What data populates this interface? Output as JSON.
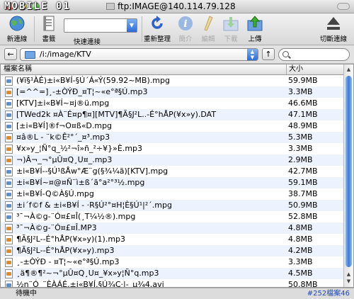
{
  "window": {
    "title": "ftp:IMAGE@140.114.79.128",
    "watermark": "MOBILE 01"
  },
  "toolbar": {
    "new_connection": "新連線",
    "bookmarks": "書籤",
    "quick_connect": "快速連接",
    "refresh": "重新整理",
    "info": "簡介",
    "edit": "編輯",
    "download": "下載",
    "upload": "上傳",
    "disconnect": "切斷連線"
  },
  "pathbar": {
    "path": "/i:/image/KTV",
    "back_label": "←",
    "up_label": "↑"
  },
  "list": {
    "header_name": "檔案名稱",
    "header_size": "大小",
    "rows": [
      {
        "name": "(¥ï§¹ÀÉ)±i«B¥Í-§Ú´Á«Ý(59.92~MB).mpg",
        "size": "59.9MB",
        "kind": "video"
      },
      {
        "name": "[=^^=]¸-±ÒÝÐ_¤T¦~«e°ª§Ú.mp3",
        "size": "3.3MB",
        "kind": "audio"
      },
      {
        "name": "[KTV]±i«B¥Í~¤j®ü.mpg",
        "size": "46.6MB",
        "kind": "video"
      },
      {
        "name": "[TWed2k ¤À¨É¤p¶¤][MTV]¶Ã§J²L..-É°hÅP(¥x»y).DAT",
        "size": "47.1MB",
        "kind": "video"
      },
      {
        "name": "[±i«B¥Í]®f¬O¤ß«D.mpg",
        "size": "48.9MB",
        "kind": "video"
      },
      {
        "name": "¤â®L - ¨k©Ê²°´_¤³.mp3",
        "size": "5.3MB",
        "kind": "audio"
      },
      {
        "name": "¥x»y_¦Ñ°q_½²¬î»ñ_²÷¥}»È.mp3",
        "size": "3.3MB",
        "kind": "audio"
      },
      {
        "name": "¬)Â¬_¬°µÛ¤Q¸U¤_.mp3",
        "size": "2.9MB",
        "kind": "audio"
      },
      {
        "name": "±i«B¥Í--§Ú¹ßÅw°Æ¨g(§¾¼ã)[KTV].mpg",
        "size": "42.7MB",
        "kind": "video"
      },
      {
        "name": "±i«B¥Í~¤@¤Ñ¨ì±ß´ã°a²°³½.mpg",
        "size": "59.1MB",
        "kind": "video"
      },
      {
        "name": "±i«B¥Í-Q©À§Ú.mpg",
        "size": "38.7MB",
        "kind": "video"
      },
      {
        "name": "±i´f©f & ±i«B¥Í - ·R§Ú²°¤H¦È§Ú¹|²´.mpg",
        "size": "50.9MB",
        "kind": "video"
      },
      {
        "name": "³¯¬À©g-¨Ó¤£¤Î(¸T¼½®).mpg",
        "size": "52.8MB",
        "kind": "video"
      },
      {
        "name": "³¯¬À©g-¨Ó¤£¤Î.MP3",
        "size": "4.8MB",
        "kind": "audio"
      },
      {
        "name": "¶Ã§J²L--É°hÅP(¥x»y)(1).mp3",
        "size": "4.8MB",
        "kind": "audio"
      },
      {
        "name": "¶Ã§J²L--É°hÅP(¥x»y).mp3",
        "size": "4.2MB",
        "kind": "audio"
      },
      {
        "name": "¸-±ÒÝÐ - ¤T¦~«e°ª§Ú.mp3",
        "size": "3.3MB",
        "kind": "audio"
      },
      {
        "name": "¸ä¶®¶²~¬°µÛ¤Q¸U¤_¥x»y¦Ñ°q.mp3",
        "size": "4.5MB",
        "kind": "audio"
      },
      {
        "name": "½n¨Ó¸¨ÈÀÁÉ.±i«B¥Í.§Ú¾Ç·|-_µ¾4.avi",
        "size": "50.8MB",
        "kind": "video"
      },
      {
        "name": "¼½¬ö¤¸ ¤Q¨ª¤@¨,¨L.mpg",
        "size": "44.8MB",
        "kind": "video"
      }
    ]
  },
  "status": {
    "text": "待機中",
    "count": "#252檔案46"
  }
}
